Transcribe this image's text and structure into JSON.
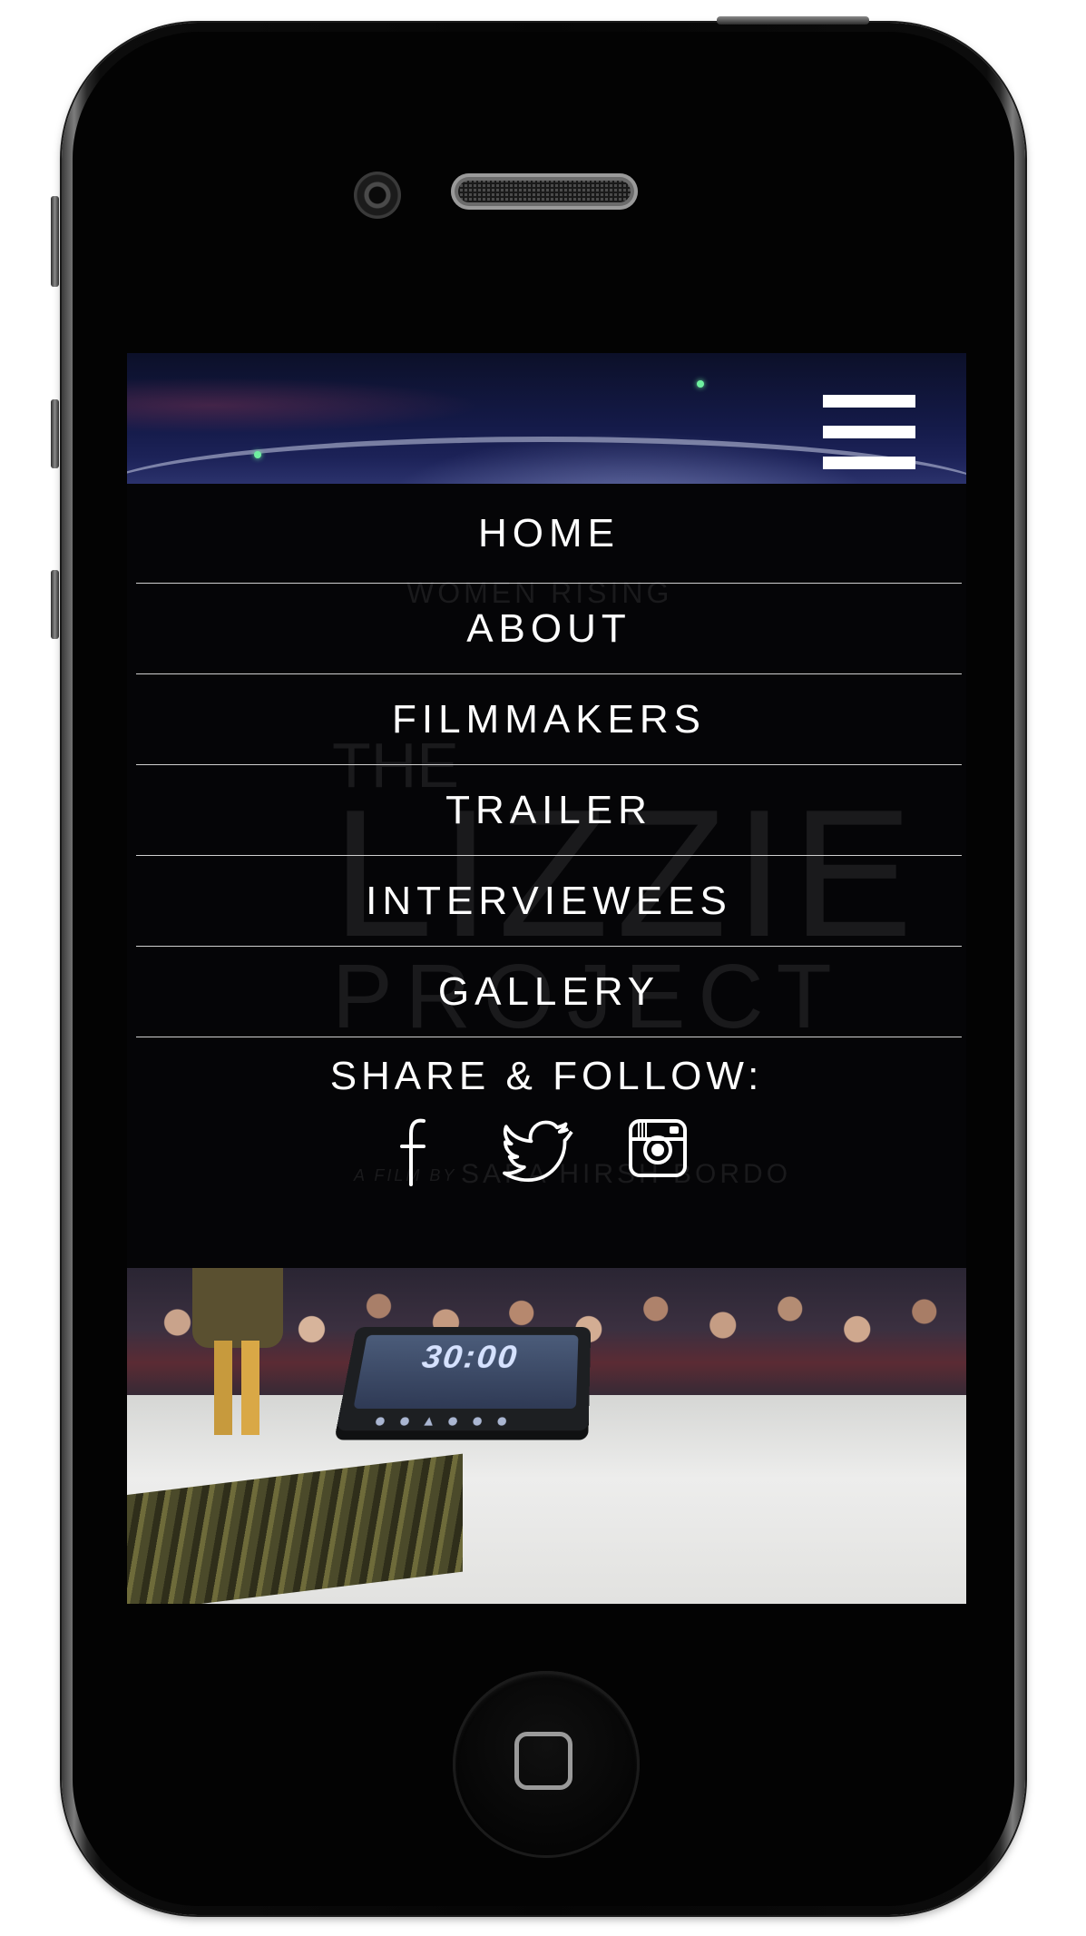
{
  "nav": {
    "items": [
      {
        "label": "HOME"
      },
      {
        "label": "ABOUT"
      },
      {
        "label": "FILMMAKERS"
      },
      {
        "label": "TRAILER"
      },
      {
        "label": "INTERVIEWEES"
      },
      {
        "label": "GALLERY"
      }
    ],
    "share_heading": "SHARE & FOLLOW:",
    "social": [
      "facebook-icon",
      "twitter-icon",
      "instagram-icon"
    ]
  },
  "backdrop": {
    "tagline": "WOMEN RISING",
    "title_small": "THE",
    "title_main": "LIZZIE",
    "title_sub": "PROJECT",
    "credit_prefix": "A FILM BY",
    "credit_name": "SARA HIRSH BORDO"
  },
  "hero": {
    "timer": "30:00"
  },
  "colors": {
    "overlay": "#050507",
    "nav_text": "#ffffff",
    "divider": "#cfcfcf"
  }
}
